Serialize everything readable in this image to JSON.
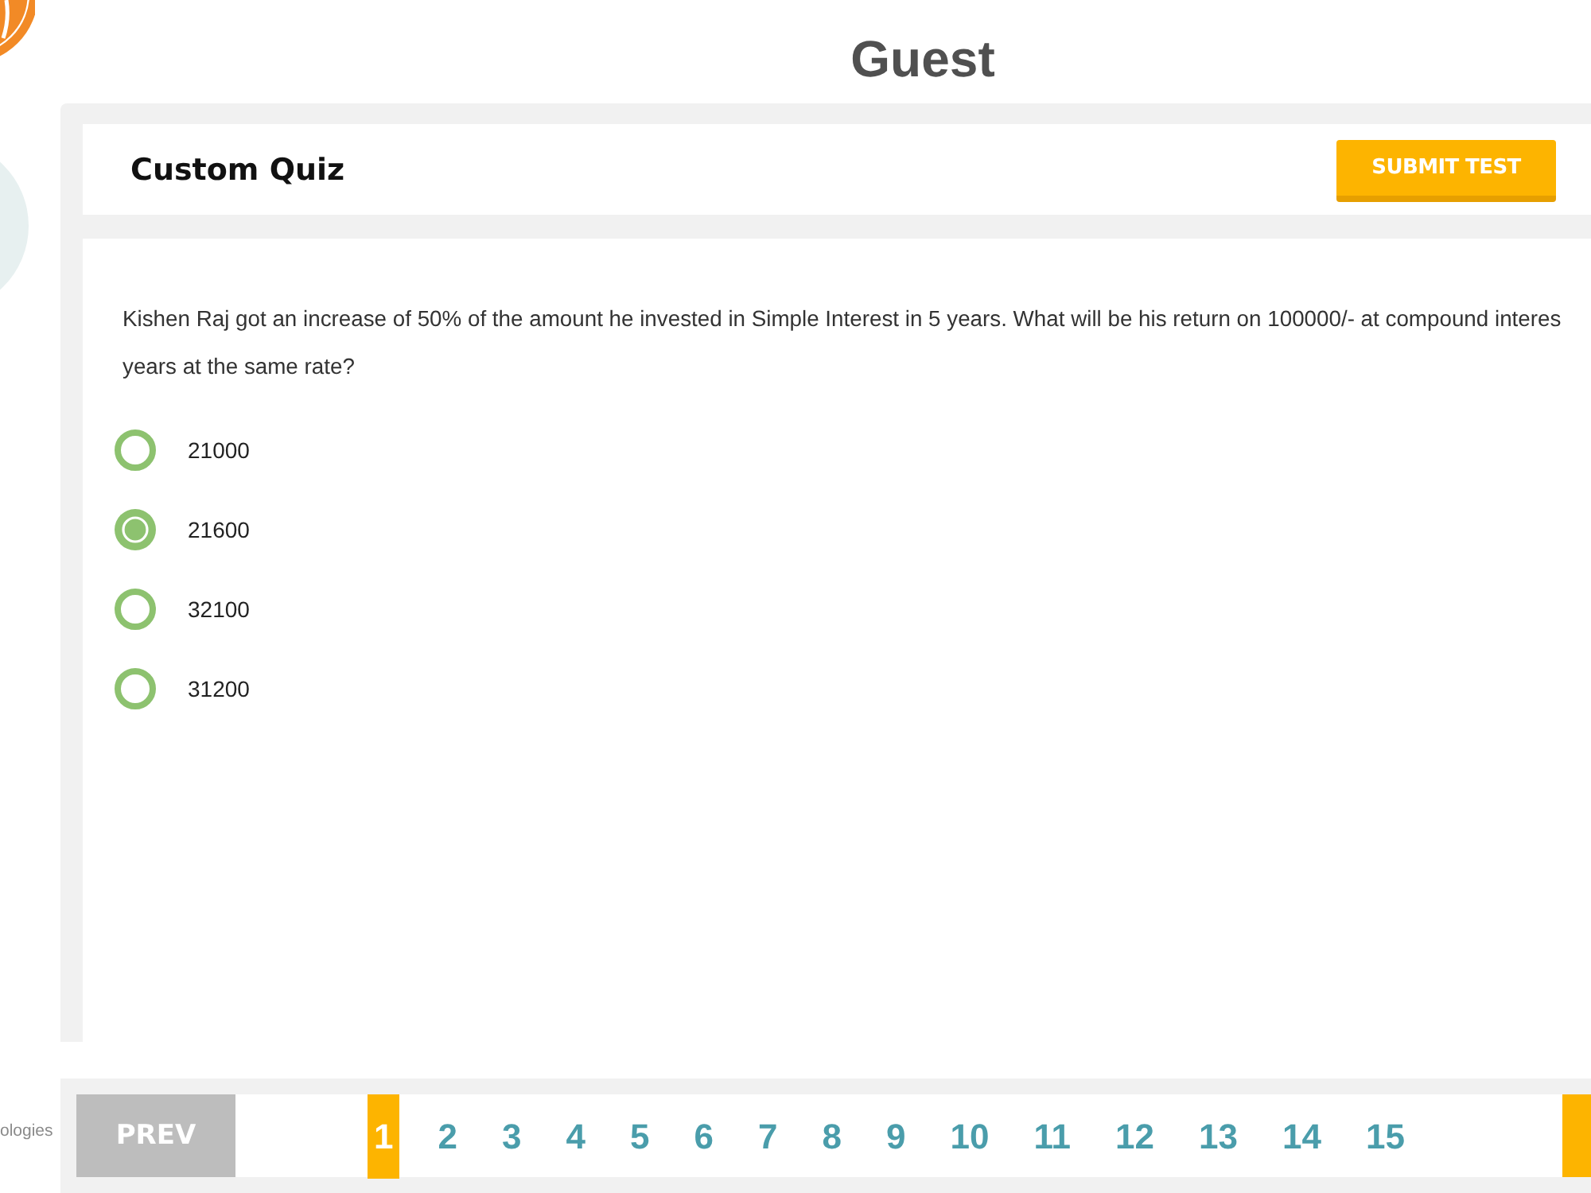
{
  "footer_fragment": "ologies",
  "header": {
    "title": "Guest"
  },
  "quiz": {
    "title": "Custom Quiz",
    "submit_button": "SUBMIT TEST"
  },
  "question": {
    "lines": [
      "Kishen Raj got an increase of 50% of the amount he invested in Simple Interest in 5 years. What will be his return on 100000/- at compound interes",
      "years at the same rate?"
    ],
    "options": [
      {
        "label": "21000",
        "selected": false
      },
      {
        "label": "21600",
        "selected": true
      },
      {
        "label": "32100",
        "selected": false
      },
      {
        "label": "31200",
        "selected": false
      }
    ]
  },
  "pager": {
    "prev_button": "PREV",
    "pages": [
      {
        "label": "1",
        "selected": true
      },
      {
        "label": "2",
        "selected": false
      },
      {
        "label": "3",
        "selected": false
      },
      {
        "label": "4",
        "selected": false
      },
      {
        "label": "5",
        "selected": false
      },
      {
        "label": "6",
        "selected": false
      },
      {
        "label": "7",
        "selected": false
      },
      {
        "label": "8",
        "selected": false
      },
      {
        "label": "9",
        "selected": false
      },
      {
        "label": "10",
        "selected": false
      },
      {
        "label": "11",
        "selected": false
      },
      {
        "label": "12",
        "selected": false
      },
      {
        "label": "13",
        "selected": false
      },
      {
        "label": "14",
        "selected": false
      },
      {
        "label": "15",
        "selected": false
      }
    ]
  }
}
